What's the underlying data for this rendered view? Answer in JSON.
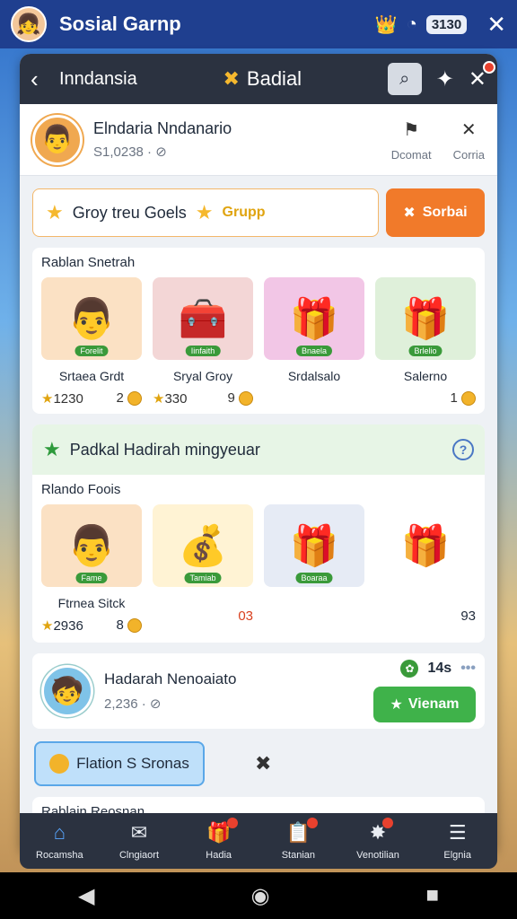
{
  "statusbar": {
    "app_title": "Sosial Garnp",
    "battery": "3130"
  },
  "nav": {
    "back_label": "Inndansia",
    "center_title": "Badial"
  },
  "profile": {
    "name": "Elndaria Nndanario",
    "sub": "S1,0238",
    "action1": "Dcomat",
    "action2": "Corria"
  },
  "goals": {
    "label": "Groy treu Goels",
    "badge": "Grupp",
    "button": "Sorbai"
  },
  "section1": {
    "title": "Rablan Snetrah",
    "items": [
      {
        "name": "Srtaea Grdt",
        "stars": "1230",
        "coins": "2",
        "tag": "Forelit",
        "emoji": "👨",
        "bg": "#fbe1c4"
      },
      {
        "name": "Sryal Groy",
        "stars": "330",
        "coins": "9",
        "tag": "Iinfaith",
        "emoji": "🧰",
        "bg": "#f3d6d6"
      },
      {
        "name": "Srdalsalo",
        "stars": "",
        "coins": "",
        "tag": "Bnaela",
        "emoji": "🎁",
        "bg": "#f2c6e6"
      },
      {
        "name": "Salerno",
        "stars": "",
        "coins": "1",
        "tag": "Brlelio",
        "emoji": "🎁",
        "bg": "#dff0da"
      }
    ]
  },
  "weekly": {
    "title": "Padkal Hadirah mingyeuar",
    "section_title": "Rlando Foois",
    "items": [
      {
        "name": "Ftrnea Sitck",
        "val": "2936",
        "coins": "8",
        "tag": "Fame",
        "emoji": "👨",
        "bg": "#fbe1c4"
      },
      {
        "name": "",
        "val": "",
        "coins": "03",
        "tag": "Tamiab",
        "emoji": "💰",
        "bg": "#fff3d4"
      },
      {
        "name": "",
        "val": "",
        "coins": "",
        "tag": "Boaraa",
        "emoji": "🎁",
        "bg": "#e6ebf5"
      },
      {
        "name": "",
        "val": "",
        "coins": "93",
        "tag": "",
        "emoji": "🎁",
        "bg": "#ffffff"
      }
    ]
  },
  "friend": {
    "name": "Hadarah Nenoaiato",
    "sub": "2,236",
    "count": "14s",
    "button": "Vienam"
  },
  "bonus": {
    "label": "Flation S Sronas"
  },
  "bottom": {
    "title": "Rablain Reosnan"
  },
  "tabs": [
    {
      "label": "Rocamsha",
      "icon": "⌂"
    },
    {
      "label": "Clngiaort",
      "icon": "✉"
    },
    {
      "label": "Hadia",
      "icon": "🎁"
    },
    {
      "label": "Stanian",
      "icon": "📋"
    },
    {
      "label": "Venotilian",
      "icon": "✸"
    },
    {
      "label": "Elgnia",
      "icon": "☰"
    }
  ]
}
